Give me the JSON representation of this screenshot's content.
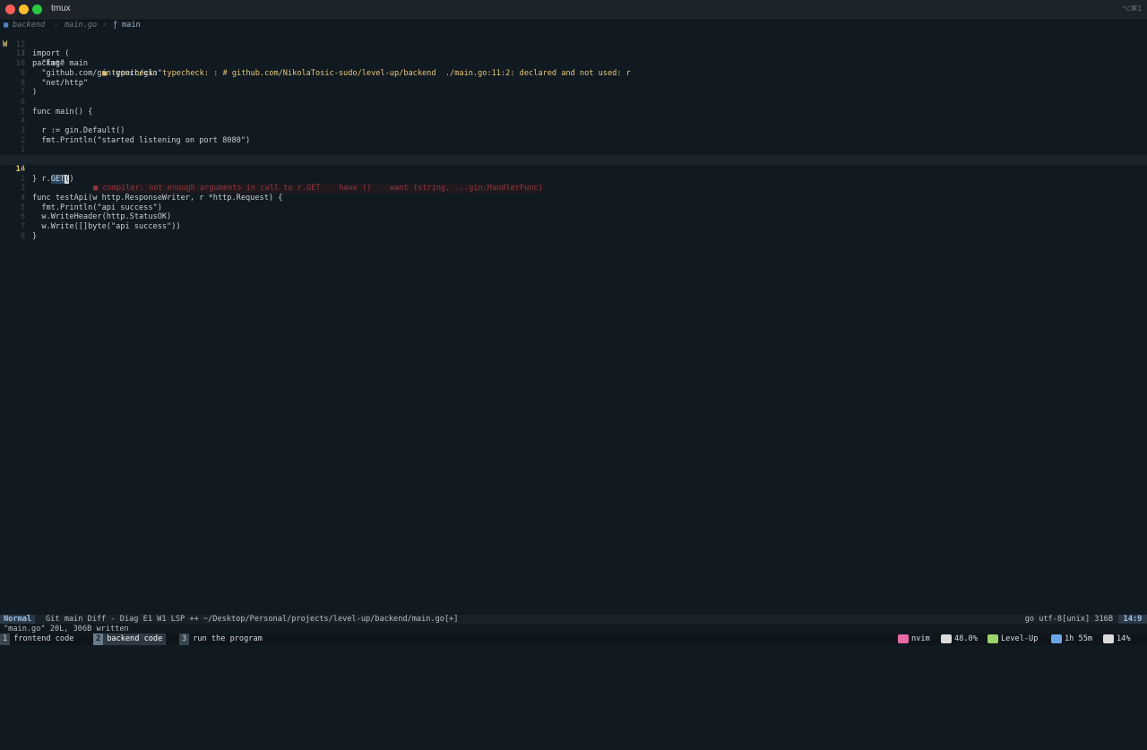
{
  "window": {
    "title": "tmux",
    "shortcut": "⌥⌘1"
  },
  "winbar": {
    "folder": "backend",
    "sep": "›",
    "file": "main.go",
    "fn_icon": "ƒ",
    "symbol": "main"
  },
  "editor": {
    "lines": [
      {
        "num": "13",
        "sign": "W",
        "code": "package main",
        "diag": "typecheck: typecheck: : # github.com/NikolaTosic-sudo/level-up/backend  ./main.go:11:2: declared and not used: r"
      },
      {
        "num": "12",
        "code": ""
      },
      {
        "num": "11",
        "code": "import ("
      },
      {
        "num": "10",
        "code": "  \"fmt\""
      },
      {
        "num": "9",
        "code": "  \"github.com/gin-gonic/gin\""
      },
      {
        "num": "8",
        "code": "  \"net/http\""
      },
      {
        "num": "7",
        "code": ")"
      },
      {
        "num": "6",
        "code": ""
      },
      {
        "num": "5",
        "code": "func main() {"
      },
      {
        "num": "4",
        "code": ""
      },
      {
        "num": "3",
        "code": "  r := gin.Default()"
      },
      {
        "num": "2",
        "code": "  fmt.Println(\"started listening on port 8080\")"
      },
      {
        "num": "1",
        "code": ""
      },
      {
        "num": "14",
        "current": true,
        "code_pre": "  r.",
        "code_sel": "GET",
        "code_cursor": "(",
        "code_post": ")",
        "virt": "■ compiler: not enough arguments in call to r.GET    have ()    want (string, ...gin.HandlerFunc)"
      },
      {
        "num": "1",
        "code": ""
      },
      {
        "num": "2",
        "code": "}"
      },
      {
        "num": "3",
        "code": ""
      },
      {
        "num": "4",
        "code": "func testApi(w http.ResponseWriter, r *http.Request) {"
      },
      {
        "num": "5",
        "code": "  fmt.Println(\"api success\")"
      },
      {
        "num": "6",
        "code": "  w.WriteHeader(http.StatusOK)"
      },
      {
        "num": "7",
        "code": "  w.Write([]byte(\"api success\"))"
      },
      {
        "num": "8",
        "code": "}"
      }
    ]
  },
  "statusline": {
    "mode": "Normal",
    "left": "Git main Diff - Diag E1 W1 LSP ++ ~/Desktop/Personal/projects/level-up/backend/main.go[+]",
    "right": "go utf-8[unix] 316B",
    "position": "14:9"
  },
  "message": "\"main.go\" 20L, 306B written",
  "tmux": {
    "windows": [
      {
        "index": "1",
        "name": "frontend code",
        "active": false
      },
      {
        "index": "2",
        "name": "backend code",
        "active": true
      },
      {
        "index": "3",
        "name": "run the program",
        "active": false
      }
    ],
    "right": [
      {
        "icon": "pink",
        "label": "nvim",
        "color": "#e86aa4"
      },
      {
        "icon": "white",
        "label": "48.0%",
        "color": "#dcdcdc"
      },
      {
        "icon": "green",
        "label": "Level-Up",
        "color": "#9bd46a"
      },
      {
        "icon": "blue",
        "label": "1h 55m",
        "color": "#6aa5e8"
      },
      {
        "icon": "white",
        "label": "14%",
        "color": "#dcdcdc"
      }
    ]
  }
}
